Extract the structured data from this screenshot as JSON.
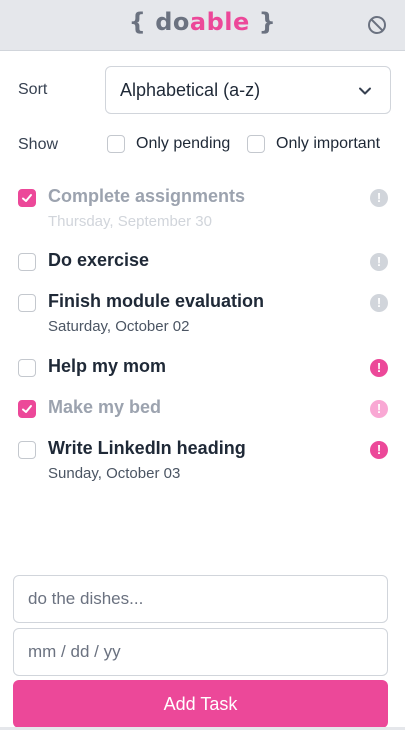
{
  "header": {
    "logo_open": "{",
    "logo_do": "do",
    "logo_able": "able",
    "logo_close": "}",
    "logout_icon": "circle-slash-icon"
  },
  "sort": {
    "label": "Sort",
    "selected": "Alphabetical (a-z)"
  },
  "show": {
    "label": "Show",
    "filters": [
      {
        "label": "Only pending",
        "checked": false
      },
      {
        "label": "Only important",
        "checked": false
      }
    ]
  },
  "tasks": [
    {
      "title": "Complete assignments",
      "date": "Thursday, September 30",
      "done": true,
      "important": false
    },
    {
      "title": "Do exercise",
      "date": "",
      "done": false,
      "important": false
    },
    {
      "title": "Finish module evaluation",
      "date": "Saturday, October 02",
      "done": false,
      "important": false
    },
    {
      "title": "Help my mom",
      "date": "",
      "done": false,
      "important": true
    },
    {
      "title": "Make my bed",
      "date": "",
      "done": true,
      "important": true
    },
    {
      "title": "Write LinkedIn heading",
      "date": "Sunday, October 03",
      "done": false,
      "important": true
    }
  ],
  "form": {
    "task_placeholder": "do the dishes...",
    "date_placeholder": "mm / dd / yy",
    "submit_label": "Add Task"
  },
  "colors": {
    "accent": "#ec4899",
    "accent_faded": "#f9a8d4",
    "important_off": "#d1d5db",
    "header_bg": "#e5e7eb"
  }
}
